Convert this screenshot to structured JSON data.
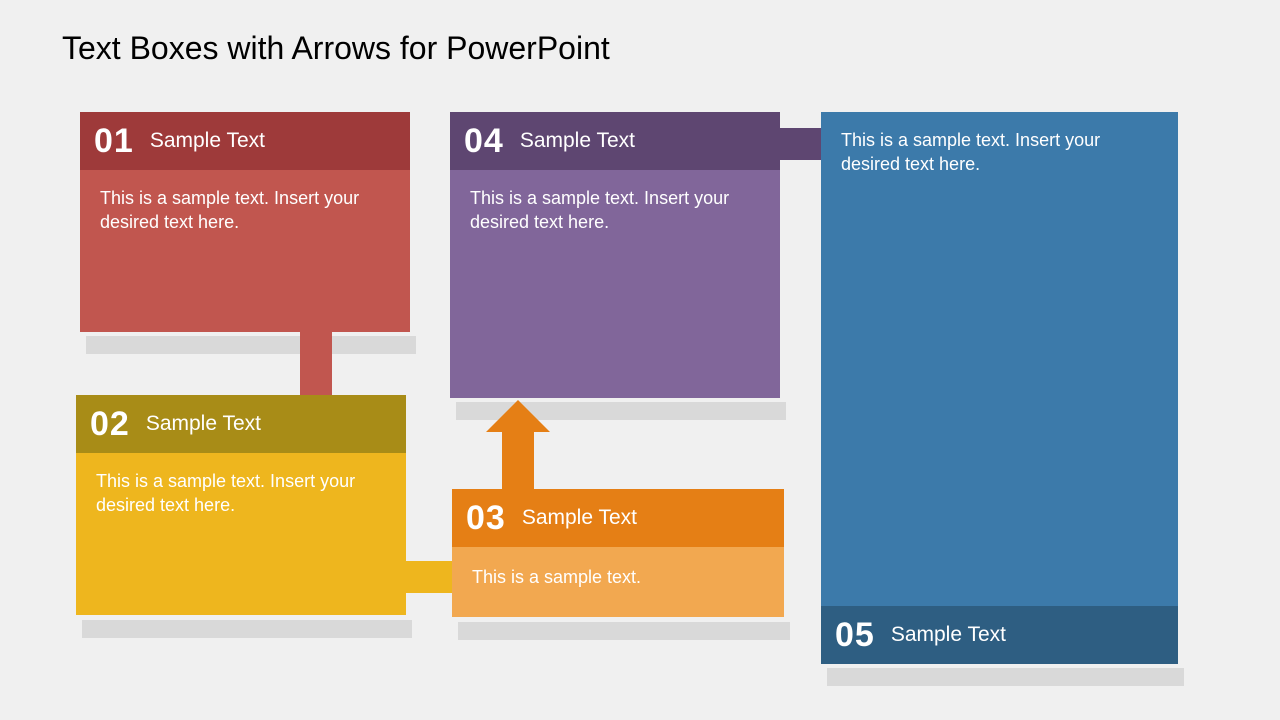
{
  "title": "Text Boxes with Arrows for PowerPoint",
  "boxes": {
    "b1": {
      "num": "01",
      "title": "Sample Text",
      "body": "This is a sample text. Insert your desired text here."
    },
    "b2": {
      "num": "02",
      "title": "Sample Text",
      "body": "This is a sample text. Insert your desired text here."
    },
    "b3": {
      "num": "03",
      "title": "Sample Text",
      "body": "This is a sample text."
    },
    "b4": {
      "num": "04",
      "title": "Sample Text",
      "body": "This is a sample text. Insert your desired text here."
    },
    "b5": {
      "num": "05",
      "title": "Sample Text",
      "body": "This is a sample text. Insert your desired text here."
    }
  }
}
